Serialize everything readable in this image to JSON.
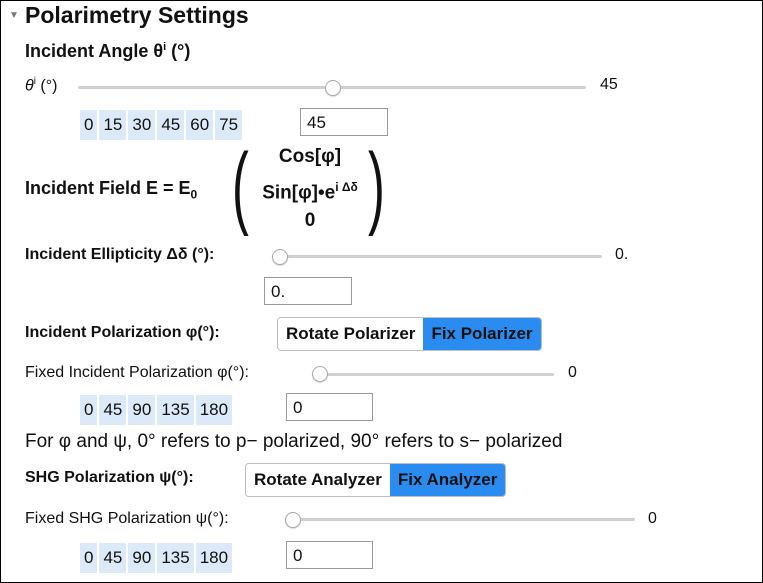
{
  "section": {
    "title": "Polarimetry Settings"
  },
  "incident_angle": {
    "heading": "Incident Angle θ",
    "heading_sup": "i",
    "heading_unit": " (°)",
    "slider_label": "θ",
    "slider_label_sup": "i",
    "slider_label_unit": " (°)",
    "value": "45",
    "slider_fraction": 0.5,
    "presets": [
      "0",
      "15",
      "30",
      "45",
      "60",
      "75"
    ],
    "input_value": "45"
  },
  "incident_field": {
    "prefix": "Incident Field E = E",
    "prefix_sub": "0",
    "row1": "Cos[φ]",
    "row2": "Sin[φ]•e",
    "row2_sup": "i Δδ",
    "row3": "0"
  },
  "ellipticity": {
    "label": "Incident Ellipticity Δδ (°):",
    "value": "0.",
    "slider_fraction": 0.0,
    "input_value": "0."
  },
  "incident_polarization": {
    "label": "Incident Polarization φ(°):",
    "options": [
      "Rotate Polarizer",
      "Fix Polarizer"
    ],
    "selected": "Fix Polarizer"
  },
  "fixed_incident": {
    "label": "Fixed Incident Polarization φ(°):",
    "value": "0",
    "slider_fraction": 0.0,
    "presets": [
      "0",
      "45",
      "90",
      "135",
      "180"
    ],
    "input_value": "0"
  },
  "note": "For φ and ψ, 0° refers to p− polarized, 90° refers to s− polarized",
  "shg_polarization": {
    "label": "SHG Polarization ψ(°):",
    "options": [
      "Rotate Analyzer",
      "Fix Analyzer"
    ],
    "selected": "Fix Analyzer"
  },
  "fixed_shg": {
    "label": "Fixed SHG Polarization ψ(°):",
    "value": "0",
    "slider_fraction": 0.0,
    "presets": [
      "0",
      "45",
      "90",
      "135",
      "180"
    ],
    "input_value": "0"
  },
  "colors": {
    "accent": "#2a8cf0",
    "chip": "#dbe9f8"
  }
}
